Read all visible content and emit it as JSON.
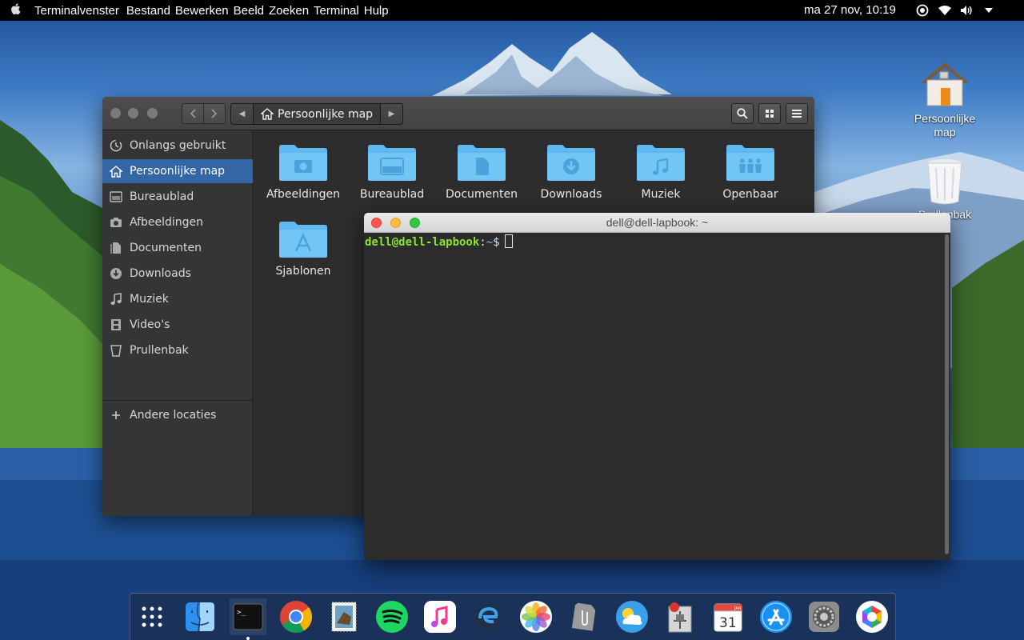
{
  "menubar": {
    "apple_icon": "apple-logo-icon",
    "app_name": "Terminalvenster",
    "menus": [
      "Bestand",
      "Bewerken",
      "Beeld",
      "Zoeken",
      "Terminal",
      "Hulp"
    ],
    "clock": "ma 27 nov, 10:19",
    "tray_icons": [
      "accessibility-icon",
      "wifi-icon",
      "volume-icon",
      "power-icon"
    ]
  },
  "file_manager": {
    "breadcrumb_current": "Persoonlijke map",
    "sidebar": {
      "items": [
        {
          "label": "Onlangs gebruikt",
          "icon": "recent-icon"
        },
        {
          "label": "Persoonlijke map",
          "icon": "home-icon",
          "active": true
        },
        {
          "label": "Bureaublad",
          "icon": "desktop-icon"
        },
        {
          "label": "Afbeeldingen",
          "icon": "camera-icon"
        },
        {
          "label": "Documenten",
          "icon": "document-icon"
        },
        {
          "label": "Downloads",
          "icon": "download-icon"
        },
        {
          "label": "Muziek",
          "icon": "music-icon"
        },
        {
          "label": "Video's",
          "icon": "film-icon"
        },
        {
          "label": "Prullenbak",
          "icon": "trash-icon"
        }
      ],
      "other_locations": "Andere locaties"
    },
    "folders": [
      {
        "label": "Afbeeldingen",
        "icon": "camera-icon"
      },
      {
        "label": "Bureaublad",
        "icon": "desktop-icon"
      },
      {
        "label": "Documenten",
        "icon": "document-icon"
      },
      {
        "label": "Downloads",
        "icon": "download-icon"
      },
      {
        "label": "Muziek",
        "icon": "music-icon"
      },
      {
        "label": "Openbaar",
        "icon": "people-icon"
      },
      {
        "label": "Sjablonen",
        "icon": "template-icon"
      }
    ]
  },
  "terminal": {
    "title": "dell@dell-lapbook: ~",
    "prompt_user": "dell@dell-lapbook",
    "prompt_sep": ":",
    "prompt_path": "~",
    "prompt_symbol": "$"
  },
  "desktop_icons": [
    {
      "label": "Persoonlijke map",
      "icon": "home-folder-icon"
    },
    {
      "label": "Prullenbak",
      "icon": "trash-can-icon"
    }
  ],
  "dock": {
    "items": [
      "app-grid-icon",
      "finder-icon",
      "terminal-icon",
      "chrome-icon",
      "mail-stamp-icon",
      "spotify-icon",
      "itunes-icon",
      "browser-icon",
      "photos-icon",
      "paperclip-icon",
      "weather-icon",
      "system-monitor-icon",
      "calendar-icon",
      "app-store-icon",
      "settings-icon",
      "camera-app-icon"
    ],
    "calendar_day": "31",
    "calendar_month": "JAN"
  }
}
